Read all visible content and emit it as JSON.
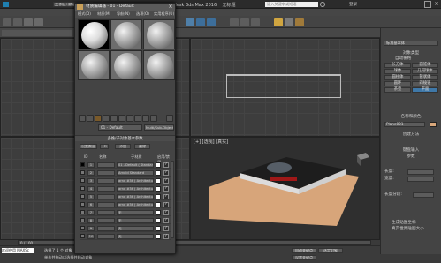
{
  "app": {
    "title": "Autodesk 3ds Max 2016",
    "file": "无标题",
    "workspace_label": "工作区: 默认",
    "search_placeholder": "键入关键字或短语",
    "login": "登录"
  },
  "viewports": {
    "perspective_label": "[+] [透视] [真实]"
  },
  "material_editor": {
    "title": "材质编辑器 - 01 - Default",
    "menu": [
      "模式(D)",
      "材质(M)",
      "导航(N)",
      "选项(O)",
      "实用程序(U)"
    ],
    "current_material": "01 - Default",
    "material_type": "Multi/Sub-Object",
    "rollout_title": "多维/子对象基本参数",
    "set_number_label": "设置数量",
    "add_label": "添加",
    "delete_label": "删除",
    "count": "10",
    "columns": {
      "id": "ID",
      "name": "名称",
      "submaterial": "子材质",
      "onoff": "启用/禁用"
    },
    "rows": [
      {
        "id": "1",
        "sub": "01 - Default ( Standard )"
      },
      {
        "id": "2",
        "sub": "Arnold Standard"
      },
      {
        "id": "3",
        "sub": "arnd #36 ( Architectural )"
      },
      {
        "id": "4",
        "sub": "arnd #36 ( Architectural )"
      },
      {
        "id": "5",
        "sub": "arnd #36 ( Architectural )"
      },
      {
        "id": "6",
        "sub": "arnd #36 ( Architectural )"
      },
      {
        "id": "7",
        "sub": "无"
      },
      {
        "id": "8",
        "sub": "无"
      },
      {
        "id": "9",
        "sub": "无"
      },
      {
        "id": "10",
        "sub": "无"
      }
    ]
  },
  "command_panel": {
    "object_type": "对象类型",
    "autogrid": "自动栅格",
    "buttons": [
      "长方体",
      "圆锥体",
      "球体",
      "几何球体",
      "圆柱体",
      "管状体",
      "圆环",
      "四棱锥",
      "茶壶",
      "平面"
    ],
    "name_color": "名称和颜色",
    "object_name": "Plane001",
    "create_method": "创建方法",
    "keyboard_entry": "键盘输入",
    "parameters": "参数",
    "length_label": "长度:",
    "width_label": "宽度:",
    "segs_label": "长度分段:",
    "generate_mapping": "生成贴图坐标",
    "real_world": "真实世界贴图大小",
    "dropdown": "标准基本体"
  },
  "timeline": {
    "frame": "0 / 100"
  },
  "status": {
    "selection": "选择了 1 个 对象",
    "hint": "单击并拖动以选择并移动对象",
    "welcome": "欢迎使用 MAXSc",
    "autokey": "自动关键点",
    "set_key": "设置关键点",
    "selected": "选定对象"
  }
}
